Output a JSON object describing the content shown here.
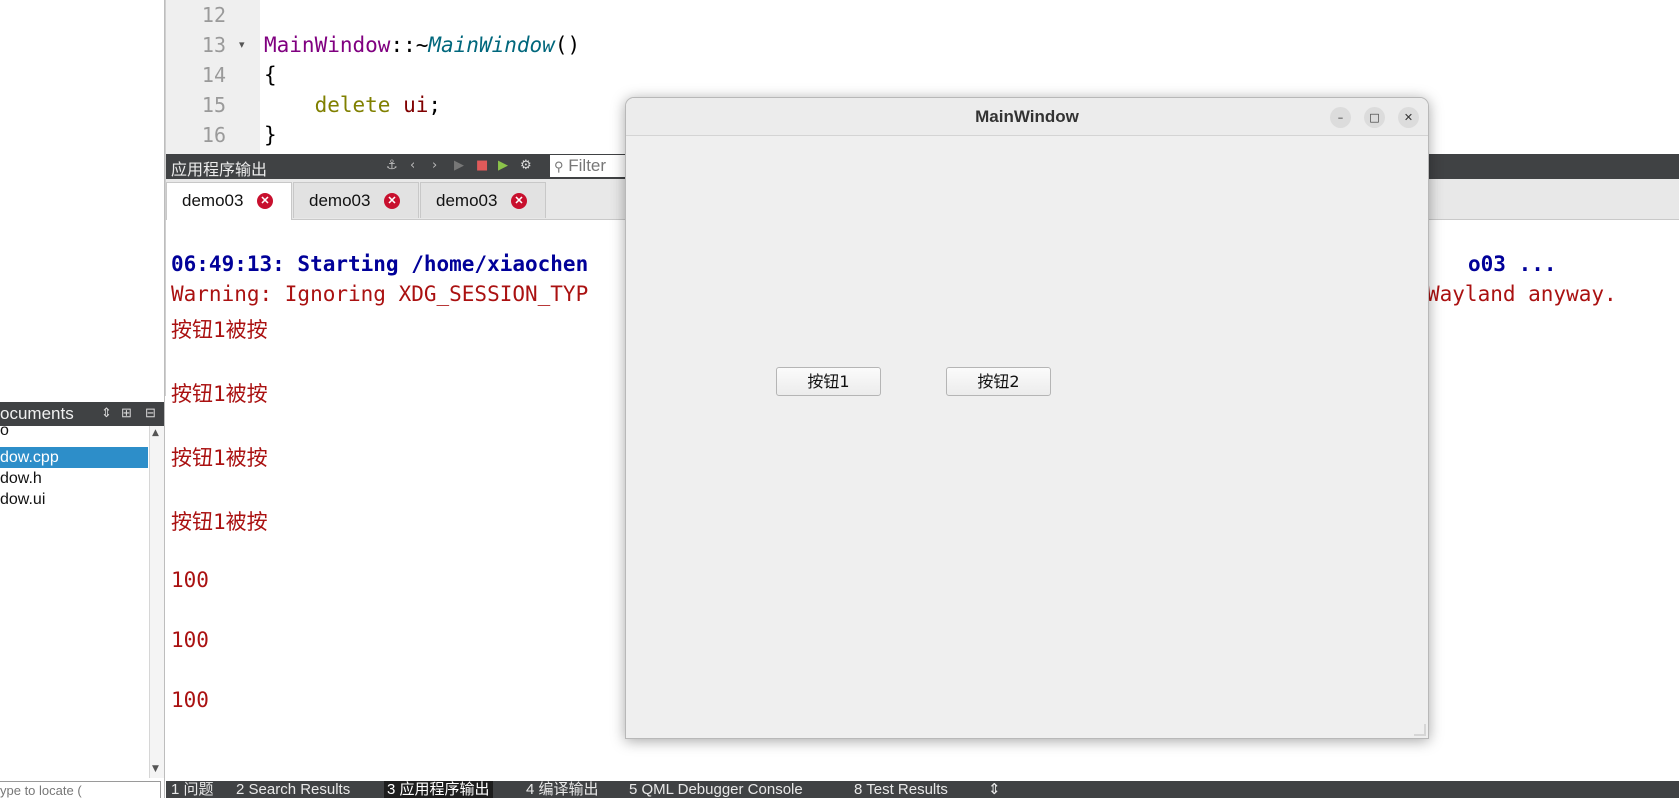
{
  "sidebar": {
    "open_documents_title": "ocuments",
    "header_controls": [
      "⇕",
      "⊞",
      "⊟"
    ],
    "documents": [
      {
        "name": "o"
      },
      {
        "name": "dow.cpp",
        "selected": true
      },
      {
        "name": "dow.h"
      },
      {
        "name": "dow.ui"
      }
    ],
    "locate_placeholder": "ype to locate ("
  },
  "editor": {
    "lines": [
      {
        "num": "12",
        "code": ""
      },
      {
        "num": "13",
        "fold": "▾"
      },
      {
        "num": "14",
        "code": "{"
      },
      {
        "num": "15"
      },
      {
        "num": "16",
        "code": "}"
      }
    ],
    "line13": {
      "class": "MainWindow",
      "sep": "::~",
      "dtor": "MainWindow",
      "parens": "()"
    },
    "line15": {
      "kw": "delete",
      "var": "ui",
      "semi": ";"
    }
  },
  "output_pane": {
    "title": "应用程序输出",
    "filter_placeholder": "Filter",
    "tabs": [
      {
        "label": "demo03",
        "active": true
      },
      {
        "label": "demo03",
        "active": false
      },
      {
        "label": "demo03",
        "active": false
      }
    ],
    "lines_left": [
      "06:49:13: Starting /home/xiaochen",
      "Warning: Ignoring XDG_SESSION_TYP",
      "按钮1被按",
      "按钮1被按",
      "按钮1被按",
      "按钮1被按",
      "100",
      "100",
      "100"
    ],
    "line1_right": "o03 ...",
    "line2_right": "Wayland anyway."
  },
  "bottom_bar": {
    "items": [
      {
        "label": "1 问题"
      },
      {
        "label": "2 Search Results"
      },
      {
        "label": "3 应用程序输出",
        "active": true
      },
      {
        "label": "4 编译输出"
      },
      {
        "label": "5 QML Debugger Console"
      },
      {
        "label": "8 Test Results"
      },
      {
        "label": "⇕"
      }
    ]
  },
  "main_window": {
    "title": "MainWindow",
    "minimize_glyph": "–",
    "maximize_glyph": "□",
    "close_glyph": "✕",
    "button1_label": "按钮1",
    "button2_label": "按钮2"
  },
  "icons": {
    "search": "search-icon",
    "close_tab": "close-icon"
  },
  "colors": {
    "dark_panel": "#404244",
    "selection": "#2d8ec9",
    "output_text": "#aa1111",
    "start_text": "#000099",
    "tab_close": "#c8102e"
  }
}
